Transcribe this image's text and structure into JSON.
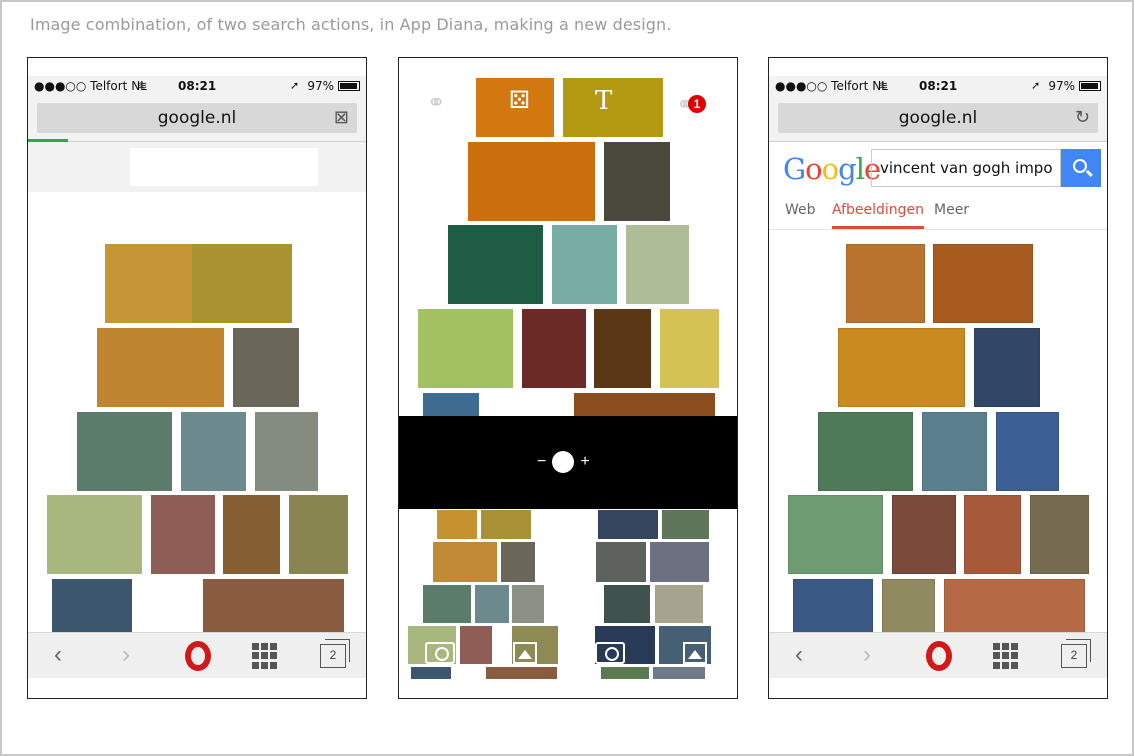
{
  "caption": "Image combination, of two search actions, in App Diana, making a new design.",
  "status": {
    "carrier": "●●●○○ Telfort NL",
    "time": "08:21",
    "battery": "97%",
    "wifi_icon": "wifi-icon",
    "location_icon": "location-arrow-icon"
  },
  "left_phone": {
    "url": "google.nl",
    "url_action_icon": "close-icon",
    "url_action_glyph": "⊠",
    "tiles": [
      {
        "color": "#c69535"
      },
      {
        "color": "#a89330"
      },
      {
        "color": "#c0862f"
      },
      {
        "color": "#6a665a"
      },
      {
        "color": "#5b7c6a"
      },
      {
        "color": "#6c8a8e"
      },
      {
        "color": "#848c80"
      },
      {
        "color": "#a8b77e"
      },
      {
        "color": "#8e5d55"
      },
      {
        "color": "#855e31"
      },
      {
        "color": "#888550"
      },
      {
        "color": "#3c566e"
      },
      {
        "color": "#8a5c3f"
      }
    ]
  },
  "middle_phone": {
    "badge_count": "1",
    "top_tiles": [
      {
        "color": "#d2780f"
      },
      {
        "color": "#b49a12"
      },
      {
        "color": "#cb6f0e"
      },
      {
        "color": "#4a473d"
      },
      {
        "color": "#1f5c44"
      },
      {
        "color": "#78aba4"
      },
      {
        "color": "#aebd96"
      },
      {
        "color": "#a2c160"
      },
      {
        "color": "#6b2a25"
      },
      {
        "color": "#5b3716"
      },
      {
        "color": "#d5c254"
      },
      {
        "color": "#3e6b90"
      },
      {
        "color": "#8a4e1f"
      }
    ],
    "bottom_left_tiles": [
      {
        "color": "#c6912f"
      },
      {
        "color": "#a99236"
      },
      {
        "color": "#c08936"
      },
      {
        "color": "#6a665a"
      },
      {
        "color": "#5b7c6a"
      },
      {
        "color": "#6c8a8e"
      },
      {
        "color": "#8c9185"
      },
      {
        "color": "#a8b77e"
      },
      {
        "color": "#8e5d55"
      },
      {
        "color": "#8d8a54"
      },
      {
        "color": "#3c566e"
      },
      {
        "color": "#8a5c3f"
      }
    ],
    "bottom_right_tiles": [
      {
        "color": "#35455e"
      },
      {
        "color": "#5e7559"
      },
      {
        "color": "#5e625e"
      },
      {
        "color": "#6d7080"
      },
      {
        "color": "#40524e"
      },
      {
        "color": "#a6a48e"
      },
      {
        "color": "#283a56"
      },
      {
        "color": "#455f74"
      },
      {
        "color": "#5c7a52"
      },
      {
        "color": "#6e7a88"
      }
    ],
    "zoom_minus": "−",
    "zoom_plus": "+"
  },
  "right_phone": {
    "url": "google.nl",
    "url_action_icon": "reload-icon",
    "url_action_glyph": "↻",
    "google_logo": "Google",
    "search_value": "vincent van gogh impo",
    "tabs": [
      {
        "label": "Web"
      },
      {
        "label": "Afbeeldingen"
      },
      {
        "label": "Meer"
      }
    ],
    "thumbs": [
      {
        "color": "#b8732e"
      },
      {
        "color": "#a85c20"
      },
      {
        "color": "#c98a20"
      },
      {
        "color": "#304866"
      },
      {
        "color": "#4e7a5a"
      },
      {
        "color": "#5c7f8d"
      },
      {
        "color": "#3c5f95"
      },
      {
        "color": "#6e9c70"
      },
      {
        "color": "#7a4a3a"
      },
      {
        "color": "#a65a3a"
      },
      {
        "color": "#766a50"
      },
      {
        "color": "#3a5a85"
      },
      {
        "color": "#8f8a60"
      },
      {
        "color": "#b56a45"
      }
    ]
  },
  "toolbar": {
    "back": "‹",
    "forward": "›",
    "tabs_count": "2"
  }
}
